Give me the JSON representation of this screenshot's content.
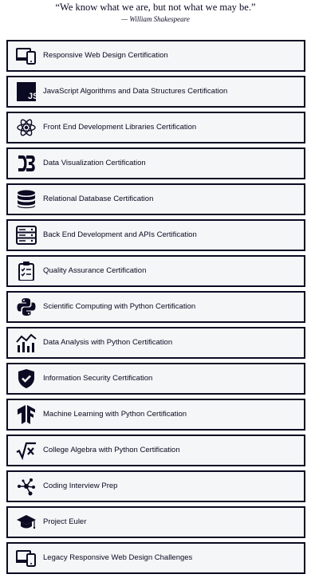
{
  "quote": {
    "text": "“We know what we are, but not what we may be.”",
    "author": "— William Shakespeare"
  },
  "certifications": [
    {
      "label": "Responsive Web Design Certification",
      "icon": "responsive-web-design-icon"
    },
    {
      "label": "JavaScript Algorithms and Data Structures Certification",
      "icon": "javascript-icon"
    },
    {
      "label": "Front End Development Libraries Certification",
      "icon": "react-icon"
    },
    {
      "label": "Data Visualization Certification",
      "icon": "d3-icon"
    },
    {
      "label": "Relational Database Certification",
      "icon": "database-icon"
    },
    {
      "label": "Back End Development and APIs Certification",
      "icon": "server-icon"
    },
    {
      "label": "Quality Assurance Certification",
      "icon": "clipboard-checklist-icon"
    },
    {
      "label": "Scientific Computing with Python Certification",
      "icon": "python-icon"
    },
    {
      "label": "Data Analysis with Python Certification",
      "icon": "chart-icon"
    },
    {
      "label": "Information Security Certification",
      "icon": "shield-check-icon"
    },
    {
      "label": "Machine Learning with Python Certification",
      "icon": "tensorflow-icon"
    },
    {
      "label": "College Algebra with Python Certification",
      "icon": "square-root-icon"
    },
    {
      "label": "Coding Interview Prep",
      "icon": "graph-nodes-icon"
    },
    {
      "label": "Project Euler",
      "icon": "graduation-cap-icon"
    },
    {
      "label": "Legacy Responsive Web Design Challenges",
      "icon": "responsive-web-design-icon"
    }
  ]
}
